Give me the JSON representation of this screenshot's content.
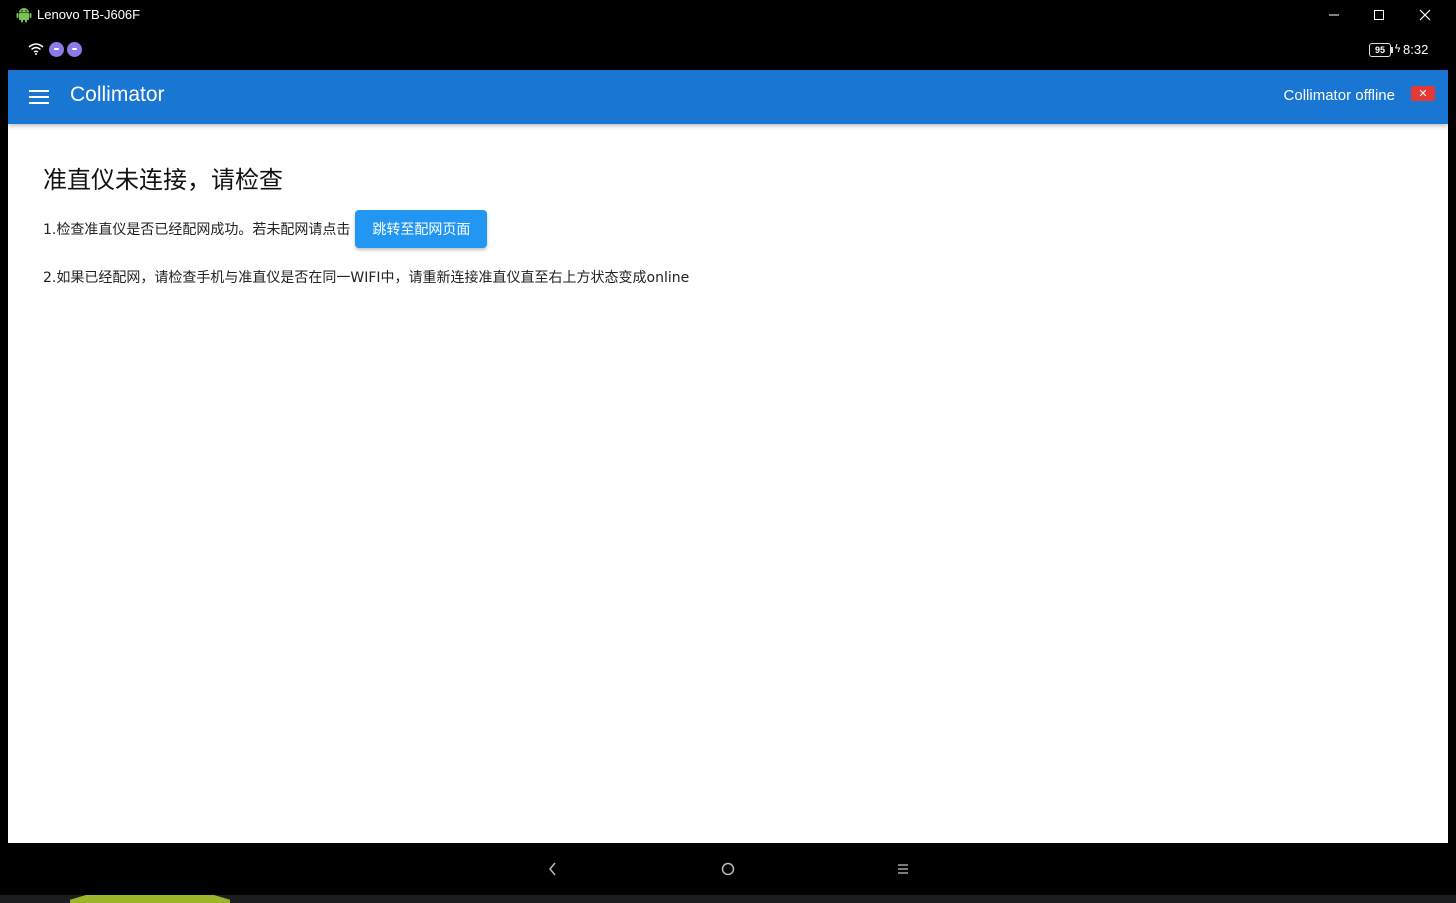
{
  "window": {
    "title": "Lenovo TB-J606F",
    "icons": [
      "android-icon",
      "minimize-icon",
      "maximize-icon",
      "close-icon"
    ]
  },
  "statusbar": {
    "battery": "95",
    "time": "8:32",
    "icons": [
      "wifi-icon",
      "notification-dot-icon",
      "notification-dot-icon",
      "charging-bolt-icon"
    ]
  },
  "appbar": {
    "title": "Collimator",
    "status_text": "Collimator offline",
    "status_badge": "✕",
    "color": "#1976d2",
    "badge_color": "#e53935"
  },
  "content": {
    "heading": "准直仪未连接，请检查",
    "step1": "1.检查准直仪是否已经配网成功。若未配网请点击",
    "step1_button": "跳转至配网页面",
    "step2": "2.如果已经配网，请检查手机与准直仪是否在同一WIFI中，请重新连接准直仪直至右上方状态变成online",
    "button_color": "#2196f3"
  },
  "navbar": {
    "icons": [
      "back-icon",
      "home-icon",
      "recent-apps-icon"
    ]
  }
}
